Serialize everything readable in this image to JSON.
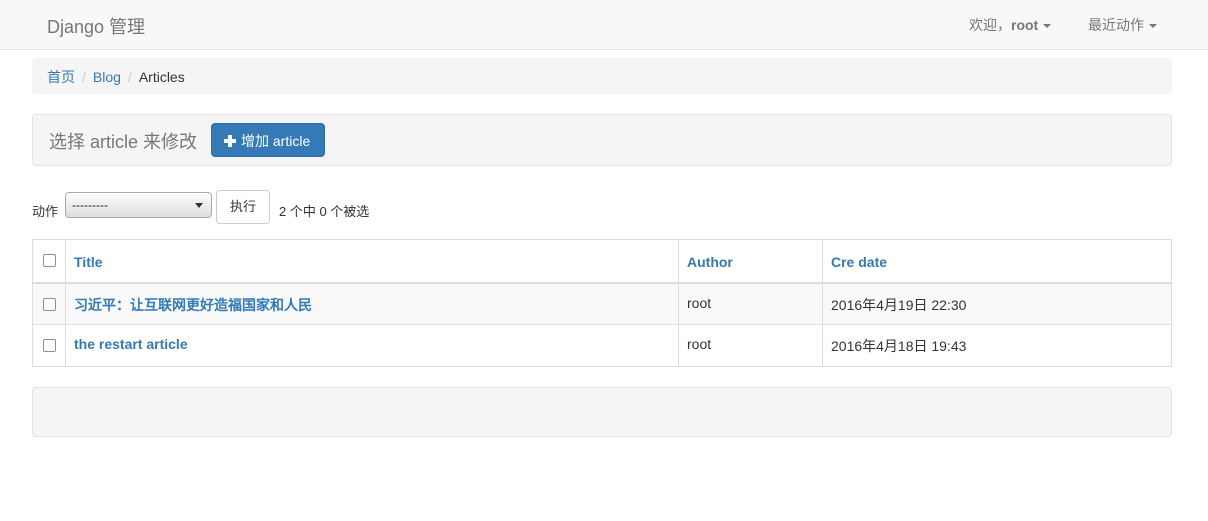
{
  "navbar": {
    "brand": "Django 管理",
    "welcome_prefix": "欢迎，",
    "username": "root",
    "recent_actions": "最近动作"
  },
  "breadcrumb": {
    "home": "首页",
    "app": "Blog",
    "current": "Articles",
    "separator": "/"
  },
  "header": {
    "title": "选择 article 来修改",
    "add_button": "增加 article"
  },
  "actions": {
    "label": "动作",
    "selected_option": "---------",
    "go_button": "执行",
    "counter": "2 个中 0 个被选"
  },
  "table": {
    "columns": [
      "Title",
      "Author",
      "Cre date"
    ],
    "rows": [
      {
        "title": "习近平：让互联网更好造福国家和人民",
        "author": "root",
        "cre_date": "2016年4月19日 22:30"
      },
      {
        "title": "the restart article",
        "author": "root",
        "cre_date": "2016年4月18日 19:43"
      }
    ]
  },
  "colors": {
    "link": "#337ab7",
    "navbar_bg": "#f8f8f8",
    "well_bg": "#f5f5f5"
  }
}
